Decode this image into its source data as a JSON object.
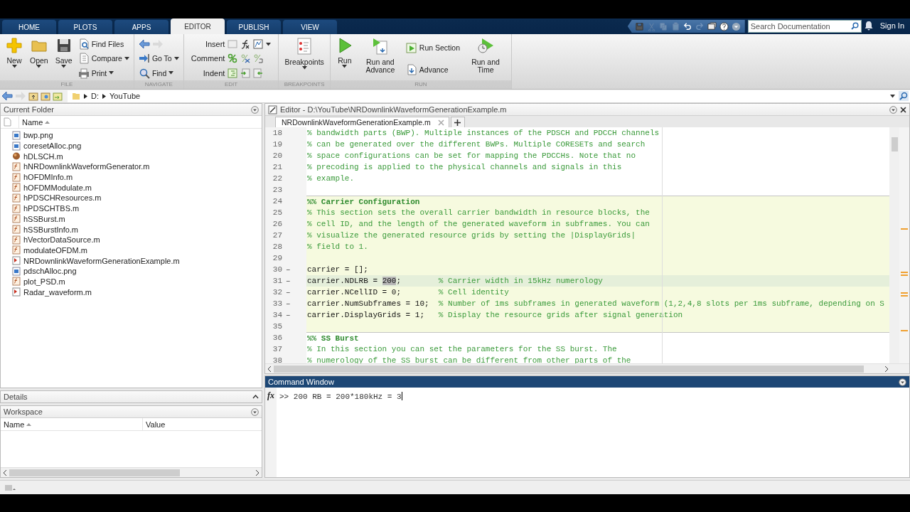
{
  "tabs": [
    {
      "label": "HOME",
      "selected": false
    },
    {
      "label": "PLOTS",
      "selected": false
    },
    {
      "label": "APPS",
      "selected": false
    },
    {
      "label": "EDITOR",
      "selected": true
    },
    {
      "label": "PUBLISH",
      "selected": false
    },
    {
      "label": "VIEW",
      "selected": false
    }
  ],
  "quick_access": [
    {
      "disabled": false
    },
    {
      "disabled": true
    },
    {
      "disabled": true
    },
    {
      "disabled": true
    },
    {
      "disabled": false
    },
    {
      "disabled": true
    },
    {
      "disabled": false
    },
    {
      "disabled": false
    },
    {
      "disabled": false
    }
  ],
  "search": {
    "placeholder": "Search Documentation"
  },
  "sign_in": "Sign In",
  "toolstrip": {
    "sections": [
      {
        "label": "FILE",
        "groups": [
          {
            "kind": "large",
            "label": "New",
            "caret": true
          },
          {
            "kind": "large",
            "label": "Open",
            "caret": true
          },
          {
            "kind": "large",
            "label": "Save",
            "caret": true
          },
          {
            "kind": "stack",
            "items": [
              {
                "kind": "button",
                "label": "Find Files",
                "caret": false
              },
              {
                "kind": "button",
                "label": "Compare",
                "caret": true
              },
              {
                "kind": "button",
                "label": "Print",
                "caret": true
              }
            ]
          }
        ]
      },
      {
        "label": "NAVIGATE",
        "groups": [
          {
            "kind": "stack",
            "items": [
              {
                "kind": "arrows"
              },
              {
                "kind": "button",
                "label": "Go To",
                "caret": true
              },
              {
                "kind": "button",
                "label": "Find",
                "caret": true
              }
            ]
          }
        ]
      },
      {
        "label": "EDIT",
        "groups": [
          {
            "kind": "rows",
            "items": [
              {
                "label": "Insert",
                "caret": true
              },
              {
                "label": "Comment",
                "caret": false
              },
              {
                "label": "Indent",
                "caret": false
              }
            ]
          }
        ]
      },
      {
        "label": "BREAKPOINTS",
        "groups": [
          {
            "kind": "large",
            "label": "Breakpoints",
            "caret": true
          }
        ]
      },
      {
        "label": "RUN",
        "groups": [
          {
            "kind": "large",
            "label": "Run",
            "caret": true
          },
          {
            "kind": "large",
            "label": "Run and Advance",
            "caret": false
          },
          {
            "kind": "stack",
            "items": [
              {
                "kind": "button",
                "label": "Run Section",
                "caret": false
              },
              {
                "kind": "button",
                "label": "Advance",
                "caret": false
              }
            ]
          },
          {
            "kind": "large",
            "label": "Run and Time",
            "caret": false
          }
        ]
      }
    ]
  },
  "address_bar": {
    "path": [
      "D:",
      "YouTube"
    ]
  },
  "current_folder": {
    "title": "Current Folder",
    "column": "Name",
    "files": [
      {
        "name": "bwp.png",
        "kind": "image"
      },
      {
        "name": "coresetAlloc.png",
        "kind": "image"
      },
      {
        "name": "hDLSCH.m",
        "kind": "pcode"
      },
      {
        "name": "hNRDownlinkWaveformGenerator.m",
        "kind": "function"
      },
      {
        "name": "hOFDMInfo.m",
        "kind": "function"
      },
      {
        "name": "hOFDMModulate.m",
        "kind": "function"
      },
      {
        "name": "hPDSCHResources.m",
        "kind": "function"
      },
      {
        "name": "hPDSCHTBS.m",
        "kind": "function"
      },
      {
        "name": "hSSBurst.m",
        "kind": "function"
      },
      {
        "name": "hSSBurstInfo.m",
        "kind": "function"
      },
      {
        "name": "hVectorDataSource.m",
        "kind": "function"
      },
      {
        "name": "modulateOFDM.m",
        "kind": "function"
      },
      {
        "name": "NRDownlinkWaveformGenerationExample.m",
        "kind": "script"
      },
      {
        "name": "pdschAlloc.png",
        "kind": "image"
      },
      {
        "name": "plot_PSD.m",
        "kind": "function"
      },
      {
        "name": "Radar_waveform.m",
        "kind": "script"
      }
    ]
  },
  "details": {
    "title": "Details",
    "expanded": false
  },
  "workspace": {
    "title": "Workspace",
    "columns": [
      "Name",
      "Value"
    ]
  },
  "editor": {
    "title": "Editor - D:\\YouTube\\NRDownlinkWaveformGenerationExample.m",
    "tabs": [
      {
        "label": "NRDownlinkWaveformGenerationExample.m",
        "selected": true
      }
    ],
    "lines": [
      {
        "number": "18",
        "shaded": false,
        "current": false,
        "section_start": false,
        "segments": [
          {
            "kind": "comment",
            "text": "% bandwidth parts (BWP). Multiple instances of the PDSCH and PDCCH channels"
          }
        ]
      },
      {
        "number": "19",
        "shaded": false,
        "current": false,
        "section_start": false,
        "segments": [
          {
            "kind": "comment",
            "text": "% can be generated over the different BWPs. Multiple CORESETs and search"
          }
        ]
      },
      {
        "number": "20",
        "shaded": false,
        "current": false,
        "section_start": false,
        "segments": [
          {
            "kind": "comment",
            "text": "% space configurations can be set for mapping the PDCCHs. Note that no"
          }
        ]
      },
      {
        "number": "21",
        "shaded": false,
        "current": false,
        "section_start": false,
        "segments": [
          {
            "kind": "comment",
            "text": "% precoding is applied to the physical channels and signals in this"
          }
        ]
      },
      {
        "number": "22",
        "shaded": false,
        "current": false,
        "section_start": false,
        "segments": [
          {
            "kind": "comment",
            "text": "% example."
          }
        ]
      },
      {
        "number": "23",
        "shaded": false,
        "current": false,
        "section_start": false
      },
      {
        "number": "24",
        "shaded": true,
        "current": false,
        "section_start": true,
        "segments": [
          {
            "kind": "heading",
            "text": "%% Carrier Configuration"
          }
        ]
      },
      {
        "number": "25",
        "shaded": true,
        "current": false,
        "section_start": false,
        "segments": [
          {
            "kind": "comment",
            "text": "% This section sets the overall carrier bandwidth in resource blocks, the"
          }
        ]
      },
      {
        "number": "26",
        "shaded": true,
        "current": false,
        "section_start": false,
        "segments": [
          {
            "kind": "comment",
            "text": "% cell ID, and the length of the generated waveform in subframes. You can"
          }
        ]
      },
      {
        "number": "27",
        "shaded": true,
        "current": false,
        "section_start": false,
        "segments": [
          {
            "kind": "comment",
            "text": "% visualize the generated resource grids by setting the |DisplayGrids|"
          }
        ]
      },
      {
        "number": "28",
        "shaded": true,
        "current": false,
        "section_start": false,
        "segments": [
          {
            "kind": "comment",
            "text": "% field to 1."
          }
        ]
      },
      {
        "number": "29",
        "shaded": true,
        "current": false,
        "section_start": false
      },
      {
        "number": "30",
        "marker": "–",
        "shaded": true,
        "current": false,
        "section_start": false,
        "segments": [
          {
            "kind": "code",
            "text": "carrier = [];"
          }
        ]
      },
      {
        "number": "31",
        "marker": "–",
        "shaded": true,
        "current": true,
        "section_start": false,
        "segments": [
          {
            "kind": "code",
            "text": "carrier.NDLRB = "
          },
          {
            "kind": "selection",
            "text": "200"
          },
          {
            "kind": "code",
            "text": ";        "
          },
          {
            "kind": "comment",
            "text": "% Carrier width in 15kHz numerology"
          }
        ]
      },
      {
        "number": "32",
        "marker": "–",
        "shaded": true,
        "current": false,
        "section_start": false,
        "segments": [
          {
            "kind": "code",
            "text": "carrier.NCellID = 0;        "
          },
          {
            "kind": "comment",
            "text": "% Cell identity"
          }
        ]
      },
      {
        "number": "33",
        "marker": "–",
        "shaded": true,
        "current": false,
        "section_start": false,
        "segments": [
          {
            "kind": "code",
            "text": "carrier.NumSubframes = 10;  "
          },
          {
            "kind": "comment",
            "text": "% Number of 1ms subframes in generated waveform (1,2,4,8 slots per 1ms subframe, depending on S"
          }
        ]
      },
      {
        "number": "34",
        "marker": "–",
        "shaded": true,
        "current": false,
        "section_start": false,
        "segments": [
          {
            "kind": "code",
            "text": "carrier.DisplayGrids = 1;   "
          },
          {
            "kind": "comment",
            "text": "% Display the resource grids after signal generation"
          }
        ]
      },
      {
        "number": "35",
        "shaded": true,
        "current": false,
        "section_start": false
      },
      {
        "number": "36",
        "shaded": false,
        "current": false,
        "section_start": true,
        "segments": [
          {
            "kind": "heading",
            "text": "%% SS Burst"
          }
        ]
      },
      {
        "number": "37",
        "shaded": false,
        "current": false,
        "section_start": false,
        "segments": [
          {
            "kind": "comment",
            "text": "% In this section you can set the parameters for the SS burst. The"
          }
        ]
      },
      {
        "number": "38",
        "shaded": false,
        "current": false,
        "section_start": false,
        "segments": [
          {
            "kind": "comment",
            "text": "% numerology of the SS burst can be different from other parts of the"
          }
        ]
      }
    ]
  },
  "command_window": {
    "title": "Command Window",
    "prompt_symbol": "fx",
    "line": ">> 200 RB = 200*180kHz = 3"
  }
}
